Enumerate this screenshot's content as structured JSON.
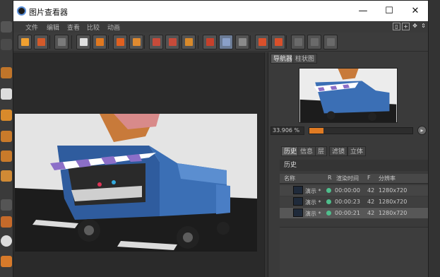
{
  "window": {
    "title": "图片查看器",
    "controls": {
      "minimize": "—",
      "maximize": "☐",
      "close": "✕"
    }
  },
  "menu": [
    "文件",
    "编辑",
    "查看",
    "比较",
    "动画"
  ],
  "menu_corner_icons": [
    "▯",
    "+",
    "✥",
    "⇕"
  ],
  "toolbar": {
    "buttons": [
      {
        "name": "open-folder-icon",
        "color": "#f0a030"
      },
      {
        "name": "save-icon",
        "color": "#d35a2a"
      },
      {
        "name": "grid-icon",
        "color": "#7a7a7a"
      },
      {
        "name": "move-icon",
        "color": "#e0e0e0"
      },
      {
        "name": "export-icon",
        "color": "#e07820"
      },
      {
        "name": "copy-icon",
        "color": "#e06020"
      },
      {
        "name": "paste-icon",
        "color": "#e08a30"
      },
      {
        "name": "frame-a-icon",
        "color": "#c74b3a"
      },
      {
        "name": "frame-b-icon",
        "color": "#c74b3a"
      },
      {
        "name": "render-icon",
        "color": "#d98a2b"
      },
      {
        "name": "compare-ab-icon",
        "color": "#c7402b"
      },
      {
        "name": "split-icon",
        "color": "#8aa0c8"
      },
      {
        "name": "swap-icon",
        "color": "#8a8a8a"
      },
      {
        "name": "set-a-icon",
        "color": "#d9502b"
      },
      {
        "name": "set-b-icon",
        "color": "#d9502b"
      },
      {
        "name": "dim-1-icon",
        "color": "#6a6a6a"
      },
      {
        "name": "dim-2-icon",
        "color": "#6a6a6a"
      },
      {
        "name": "dim-3-icon",
        "color": "#6a6a6a"
      }
    ]
  },
  "navigator": {
    "tabs": [
      "导航器",
      "柱状图"
    ],
    "zoom_value": "33.906 %",
    "zoom_fraction": 0.14,
    "zoom_reset": "▸"
  },
  "history_tabs": [
    "历史",
    "信息",
    "层",
    "滤镜",
    "立体"
  ],
  "history": {
    "section_title": "历史",
    "columns": [
      "名称",
      "R",
      "渲染时间",
      "F",
      "分辨率"
    ],
    "rows": [
      {
        "name": "演示 *",
        "time": "00:00:00",
        "frame": "42",
        "resolution": "1280x720"
      },
      {
        "name": "演示 *",
        "time": "00:00:23",
        "frame": "42",
        "resolution": "1280x720"
      },
      {
        "name": "演示 *",
        "time": "00:00:21",
        "frame": "42",
        "resolution": "1280x720"
      }
    ]
  },
  "colors": {
    "accent_orange": "#e07b23",
    "status_green": "#4fbf8d",
    "truck_blue": "#3b6fb5"
  }
}
